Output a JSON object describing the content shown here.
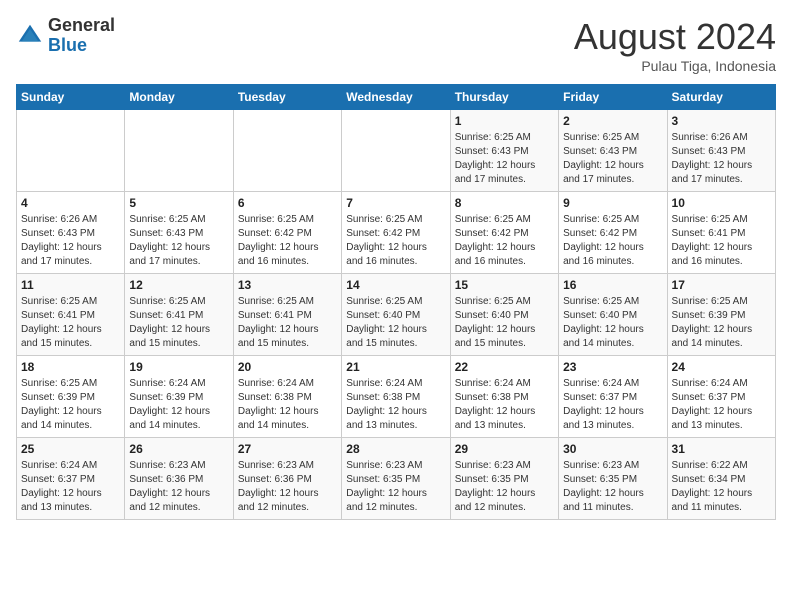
{
  "header": {
    "logo_general": "General",
    "logo_blue": "Blue",
    "month_year": "August 2024",
    "location": "Pulau Tiga, Indonesia"
  },
  "weekdays": [
    "Sunday",
    "Monday",
    "Tuesday",
    "Wednesday",
    "Thursday",
    "Friday",
    "Saturday"
  ],
  "weeks": [
    [
      {
        "day": "",
        "sunrise": "",
        "sunset": "",
        "daylight": ""
      },
      {
        "day": "",
        "sunrise": "",
        "sunset": "",
        "daylight": ""
      },
      {
        "day": "",
        "sunrise": "",
        "sunset": "",
        "daylight": ""
      },
      {
        "day": "",
        "sunrise": "",
        "sunset": "",
        "daylight": ""
      },
      {
        "day": "1",
        "sunrise": "Sunrise: 6:25 AM",
        "sunset": "Sunset: 6:43 PM",
        "daylight": "Daylight: 12 hours and 17 minutes."
      },
      {
        "day": "2",
        "sunrise": "Sunrise: 6:25 AM",
        "sunset": "Sunset: 6:43 PM",
        "daylight": "Daylight: 12 hours and 17 minutes."
      },
      {
        "day": "3",
        "sunrise": "Sunrise: 6:26 AM",
        "sunset": "Sunset: 6:43 PM",
        "daylight": "Daylight: 12 hours and 17 minutes."
      }
    ],
    [
      {
        "day": "4",
        "sunrise": "Sunrise: 6:26 AM",
        "sunset": "Sunset: 6:43 PM",
        "daylight": "Daylight: 12 hours and 17 minutes."
      },
      {
        "day": "5",
        "sunrise": "Sunrise: 6:25 AM",
        "sunset": "Sunset: 6:43 PM",
        "daylight": "Daylight: 12 hours and 17 minutes."
      },
      {
        "day": "6",
        "sunrise": "Sunrise: 6:25 AM",
        "sunset": "Sunset: 6:42 PM",
        "daylight": "Daylight: 12 hours and 16 minutes."
      },
      {
        "day": "7",
        "sunrise": "Sunrise: 6:25 AM",
        "sunset": "Sunset: 6:42 PM",
        "daylight": "Daylight: 12 hours and 16 minutes."
      },
      {
        "day": "8",
        "sunrise": "Sunrise: 6:25 AM",
        "sunset": "Sunset: 6:42 PM",
        "daylight": "Daylight: 12 hours and 16 minutes."
      },
      {
        "day": "9",
        "sunrise": "Sunrise: 6:25 AM",
        "sunset": "Sunset: 6:42 PM",
        "daylight": "Daylight: 12 hours and 16 minutes."
      },
      {
        "day": "10",
        "sunrise": "Sunrise: 6:25 AM",
        "sunset": "Sunset: 6:41 PM",
        "daylight": "Daylight: 12 hours and 16 minutes."
      }
    ],
    [
      {
        "day": "11",
        "sunrise": "Sunrise: 6:25 AM",
        "sunset": "Sunset: 6:41 PM",
        "daylight": "Daylight: 12 hours and 15 minutes."
      },
      {
        "day": "12",
        "sunrise": "Sunrise: 6:25 AM",
        "sunset": "Sunset: 6:41 PM",
        "daylight": "Daylight: 12 hours and 15 minutes."
      },
      {
        "day": "13",
        "sunrise": "Sunrise: 6:25 AM",
        "sunset": "Sunset: 6:41 PM",
        "daylight": "Daylight: 12 hours and 15 minutes."
      },
      {
        "day": "14",
        "sunrise": "Sunrise: 6:25 AM",
        "sunset": "Sunset: 6:40 PM",
        "daylight": "Daylight: 12 hours and 15 minutes."
      },
      {
        "day": "15",
        "sunrise": "Sunrise: 6:25 AM",
        "sunset": "Sunset: 6:40 PM",
        "daylight": "Daylight: 12 hours and 15 minutes."
      },
      {
        "day": "16",
        "sunrise": "Sunrise: 6:25 AM",
        "sunset": "Sunset: 6:40 PM",
        "daylight": "Daylight: 12 hours and 14 minutes."
      },
      {
        "day": "17",
        "sunrise": "Sunrise: 6:25 AM",
        "sunset": "Sunset: 6:39 PM",
        "daylight": "Daylight: 12 hours and 14 minutes."
      }
    ],
    [
      {
        "day": "18",
        "sunrise": "Sunrise: 6:25 AM",
        "sunset": "Sunset: 6:39 PM",
        "daylight": "Daylight: 12 hours and 14 minutes."
      },
      {
        "day": "19",
        "sunrise": "Sunrise: 6:24 AM",
        "sunset": "Sunset: 6:39 PM",
        "daylight": "Daylight: 12 hours and 14 minutes."
      },
      {
        "day": "20",
        "sunrise": "Sunrise: 6:24 AM",
        "sunset": "Sunset: 6:38 PM",
        "daylight": "Daylight: 12 hours and 14 minutes."
      },
      {
        "day": "21",
        "sunrise": "Sunrise: 6:24 AM",
        "sunset": "Sunset: 6:38 PM",
        "daylight": "Daylight: 12 hours and 13 minutes."
      },
      {
        "day": "22",
        "sunrise": "Sunrise: 6:24 AM",
        "sunset": "Sunset: 6:38 PM",
        "daylight": "Daylight: 12 hours and 13 minutes."
      },
      {
        "day": "23",
        "sunrise": "Sunrise: 6:24 AM",
        "sunset": "Sunset: 6:37 PM",
        "daylight": "Daylight: 12 hours and 13 minutes."
      },
      {
        "day": "24",
        "sunrise": "Sunrise: 6:24 AM",
        "sunset": "Sunset: 6:37 PM",
        "daylight": "Daylight: 12 hours and 13 minutes."
      }
    ],
    [
      {
        "day": "25",
        "sunrise": "Sunrise: 6:24 AM",
        "sunset": "Sunset: 6:37 PM",
        "daylight": "Daylight: 12 hours and 13 minutes."
      },
      {
        "day": "26",
        "sunrise": "Sunrise: 6:23 AM",
        "sunset": "Sunset: 6:36 PM",
        "daylight": "Daylight: 12 hours and 12 minutes."
      },
      {
        "day": "27",
        "sunrise": "Sunrise: 6:23 AM",
        "sunset": "Sunset: 6:36 PM",
        "daylight": "Daylight: 12 hours and 12 minutes."
      },
      {
        "day": "28",
        "sunrise": "Sunrise: 6:23 AM",
        "sunset": "Sunset: 6:35 PM",
        "daylight": "Daylight: 12 hours and 12 minutes."
      },
      {
        "day": "29",
        "sunrise": "Sunrise: 6:23 AM",
        "sunset": "Sunset: 6:35 PM",
        "daylight": "Daylight: 12 hours and 12 minutes."
      },
      {
        "day": "30",
        "sunrise": "Sunrise: 6:23 AM",
        "sunset": "Sunset: 6:35 PM",
        "daylight": "Daylight: 12 hours and 11 minutes."
      },
      {
        "day": "31",
        "sunrise": "Sunrise: 6:22 AM",
        "sunset": "Sunset: 6:34 PM",
        "daylight": "Daylight: 12 hours and 11 minutes."
      }
    ]
  ]
}
